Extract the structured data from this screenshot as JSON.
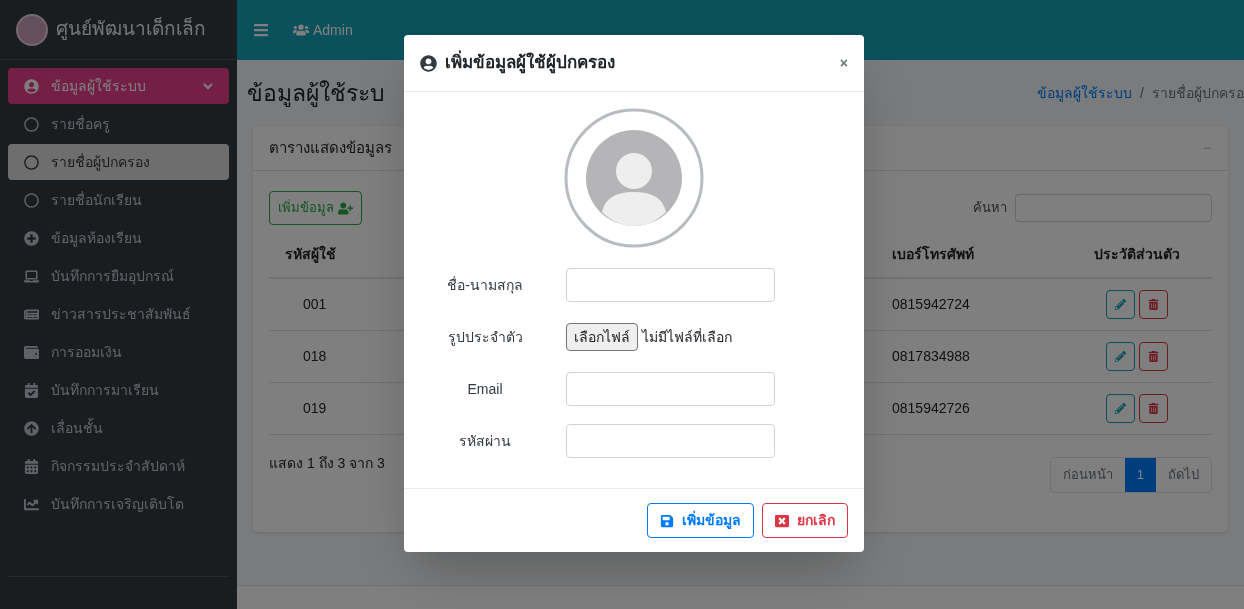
{
  "sidebar": {
    "brand": "ศูนย์พัฒนาเด็กเล็ก",
    "items": [
      {
        "label": "ข้อมูลผู้ใช้ระบบ",
        "selected": true,
        "expanded": true,
        "children": [
          {
            "label": "รายชื่อครู",
            "selected": false
          },
          {
            "label": "รายชื่อผู้ปกครอง",
            "selected": true
          },
          {
            "label": "รายชื่อนักเรียน",
            "selected": false
          }
        ]
      },
      {
        "label": "ข้อมูลห้องเรียน",
        "selected": false
      },
      {
        "label": "บันทึกการยืมอุปกรณ์",
        "selected": false
      },
      {
        "label": "ข่าวสารประชาสัมพันธ์",
        "selected": false
      },
      {
        "label": "การออมเงิน",
        "selected": false
      },
      {
        "label": "บันทึกการมาเรียน",
        "selected": false
      },
      {
        "label": "เลื่อนชั้น",
        "selected": false
      },
      {
        "label": "กิจกรรมประจำสัปดาห์",
        "selected": false
      },
      {
        "label": "บันทึกการเจริญเติบโต",
        "selected": false
      }
    ]
  },
  "topbar": {
    "user": "Admin"
  },
  "page": {
    "title": "ข้อมูลผู้ใช้ระบ",
    "breadcrumb": [
      "ข้อมูลผู้ใช้ระบบ",
      "/",
      "รายชื่อผู้ปกครอ"
    ]
  },
  "card": {
    "title": "ตารางแสดงข้อมูลร",
    "collapse": "−",
    "add_button": "เพิ่มข้อมูล",
    "search_label": "ค้นหา",
    "columns": [
      "รหัสผู้ใช้",
      "เบอร์โทรศัพท์",
      "ประวัติส่วนตัว"
    ],
    "rows": [
      {
        "code": "001",
        "phone": "0815942724"
      },
      {
        "code": "018",
        "phone": "0817834988"
      },
      {
        "code": "019",
        "phone": "0815942726"
      }
    ],
    "info": "แสดง 1 ถึง 3 จาก 3",
    "pagination": [
      {
        "label": "ก่อนหน้า",
        "selected": false
      },
      {
        "label": "1",
        "selected": true
      },
      {
        "label": "ถัดไป",
        "selected": false
      }
    ]
  },
  "modal": {
    "title": "เพิ่มข้อมูลผู้ใช้ผู้ปกครอง",
    "close": "×",
    "fields": [
      {
        "label": "ชื่อ-นามสกุล",
        "kind": "text"
      },
      {
        "label": "รูปประจำตัว",
        "kind": "file",
        "button": "เลือกไฟล์",
        "status": "ไม่มีไฟล์ที่เลือก"
      },
      {
        "label": "Email",
        "kind": "text"
      },
      {
        "label": "รหัสผ่าน",
        "kind": "password"
      }
    ],
    "buttons": [
      {
        "label": "เพิ่มข้อมูล",
        "kind": "save"
      },
      {
        "label": "ยกเลิก",
        "kind": "cancel"
      }
    ]
  }
}
